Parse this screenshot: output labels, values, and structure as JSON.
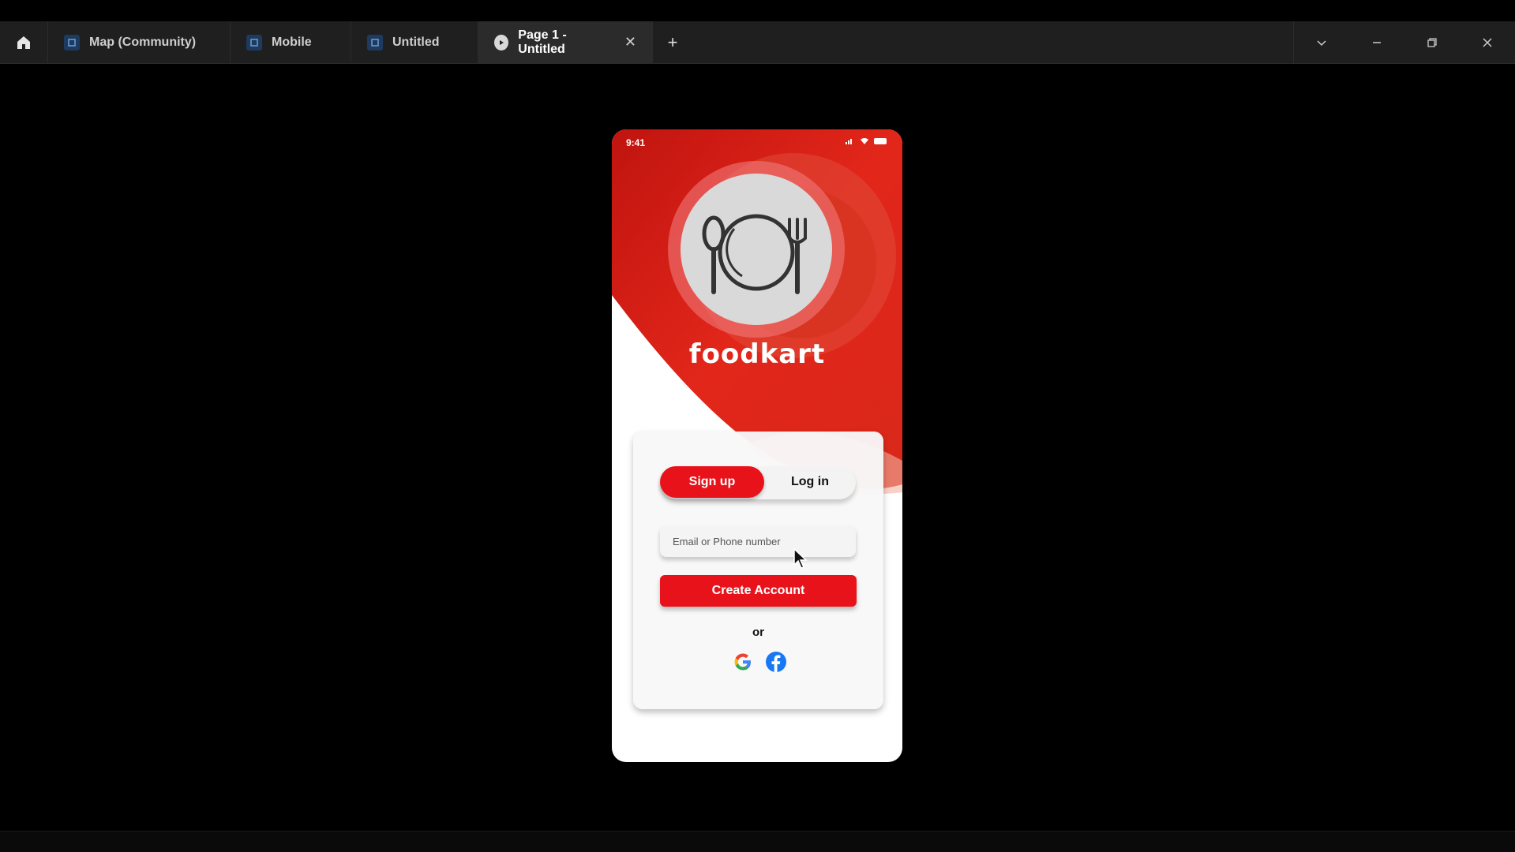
{
  "tabs": [
    {
      "label": "Map (Community)",
      "icon": "figma-file-icon"
    },
    {
      "label": "Mobile",
      "icon": "figma-file-icon"
    },
    {
      "label": "Untitled",
      "icon": "figma-file-icon"
    },
    {
      "label": "Page 1 - Untitled",
      "icon": "play-icon",
      "active": true,
      "closable": true
    }
  ],
  "window_controls": [
    "chevron-down-icon",
    "minimize-icon",
    "restore-icon",
    "close-icon"
  ],
  "app": {
    "status_time": "9:41",
    "brand": "foodkart",
    "toggle": {
      "signup_label": "Sign up",
      "login_label": "Log in",
      "selected": "Sign up"
    },
    "email_placeholder": "Email or Phone number",
    "create_label": "Create Account",
    "or_label": "or",
    "social": [
      "google-icon",
      "facebook-icon"
    ]
  },
  "colors": {
    "accent": "#e8131a",
    "tabbar": "#1f1f1f",
    "canvas": "#000000"
  }
}
